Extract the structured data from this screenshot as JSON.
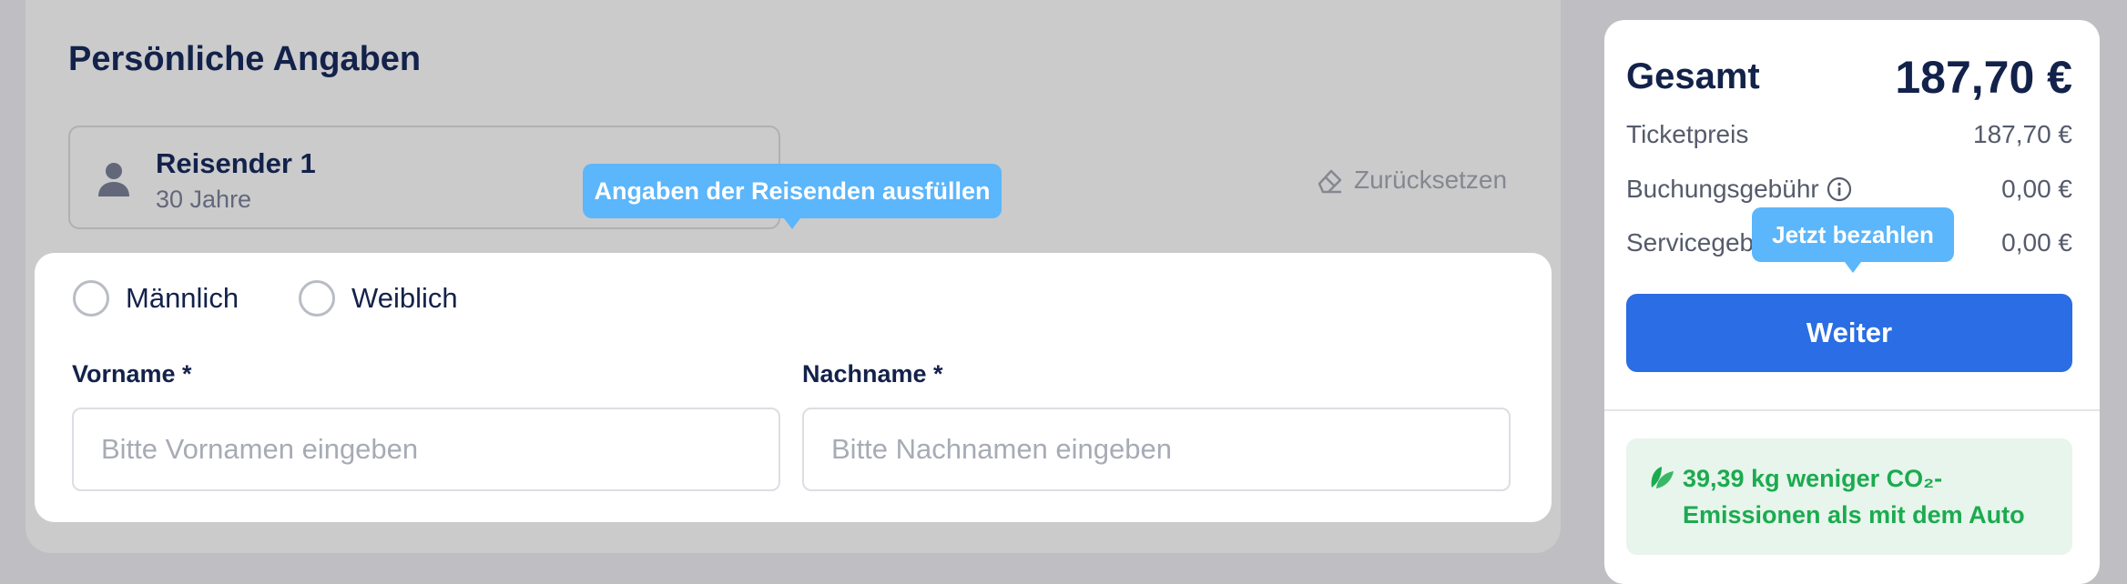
{
  "personal": {
    "title": "Persönliche Angaben",
    "traveler": {
      "name": "Reisender 1",
      "age": "30 Jahre"
    },
    "reset_label": "Zurücksetzen",
    "tooltip": "Angaben der Reisenden ausfüllen",
    "gender": {
      "male": "Männlich",
      "female": "Weiblich"
    },
    "first_name": {
      "label": "Vorname *",
      "placeholder": "Bitte Vornamen eingeben"
    },
    "last_name": {
      "label": "Nachname *",
      "placeholder": "Bitte Nachnamen eingeben"
    }
  },
  "summary": {
    "total_label": "Gesamt",
    "total_value": "187,70 €",
    "rows": [
      {
        "label": "Ticketpreis",
        "value": "187,70 €"
      },
      {
        "label": "Buchungsgebühr",
        "value": "0,00 €"
      },
      {
        "label": "Servicegeb",
        "value": "0,00 €"
      }
    ],
    "pay_tooltip": "Jetzt bezahlen",
    "continue_label": "Weiter",
    "co2_text_line1": "39,39 kg weniger CO₂-",
    "co2_text_line2": "Emissionen als mit dem Auto"
  },
  "colors": {
    "accent": "#2a6de4",
    "tooltip": "#5bb6fb",
    "eco_green": "#1bab4f"
  },
  "icons": [
    "person-icon",
    "eraser-icon",
    "info-icon",
    "leaf-icon"
  ]
}
